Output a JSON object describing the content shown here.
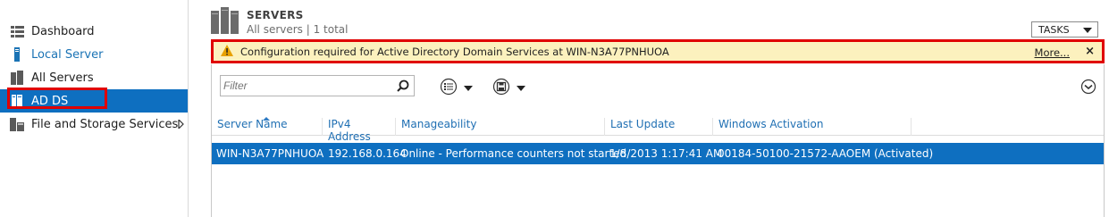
{
  "sidebar": {
    "items": [
      {
        "label": "Dashboard"
      },
      {
        "label": "Local Server"
      },
      {
        "label": "All Servers"
      },
      {
        "label": "AD DS"
      },
      {
        "label": "File and Storage Services"
      }
    ]
  },
  "header": {
    "title": "SERVERS",
    "subtitle": "All servers | 1 total",
    "tasks_label": "TASKS"
  },
  "notification": {
    "message": "Configuration required for Active Directory Domain Services at WIN-N3A77PNHUOA",
    "more_label": "More...",
    "close_label": "×"
  },
  "filter": {
    "placeholder": "Filter"
  },
  "table": {
    "columns": [
      "Server Name",
      "IPv4 Address",
      "Manageability",
      "Last Update",
      "Windows Activation"
    ],
    "rows": [
      [
        "WIN-N3A77PNHUOA",
        "192.168.0.164",
        "Online - Performance counters not started",
        "1/8/2013 1:17:41 AM",
        "00184-50100-21572-AAOEM (Activated)"
      ]
    ]
  },
  "colors": {
    "selection": "#0e6fc0",
    "highlight": "#e00000",
    "warning_bg": "#fcf1be"
  }
}
